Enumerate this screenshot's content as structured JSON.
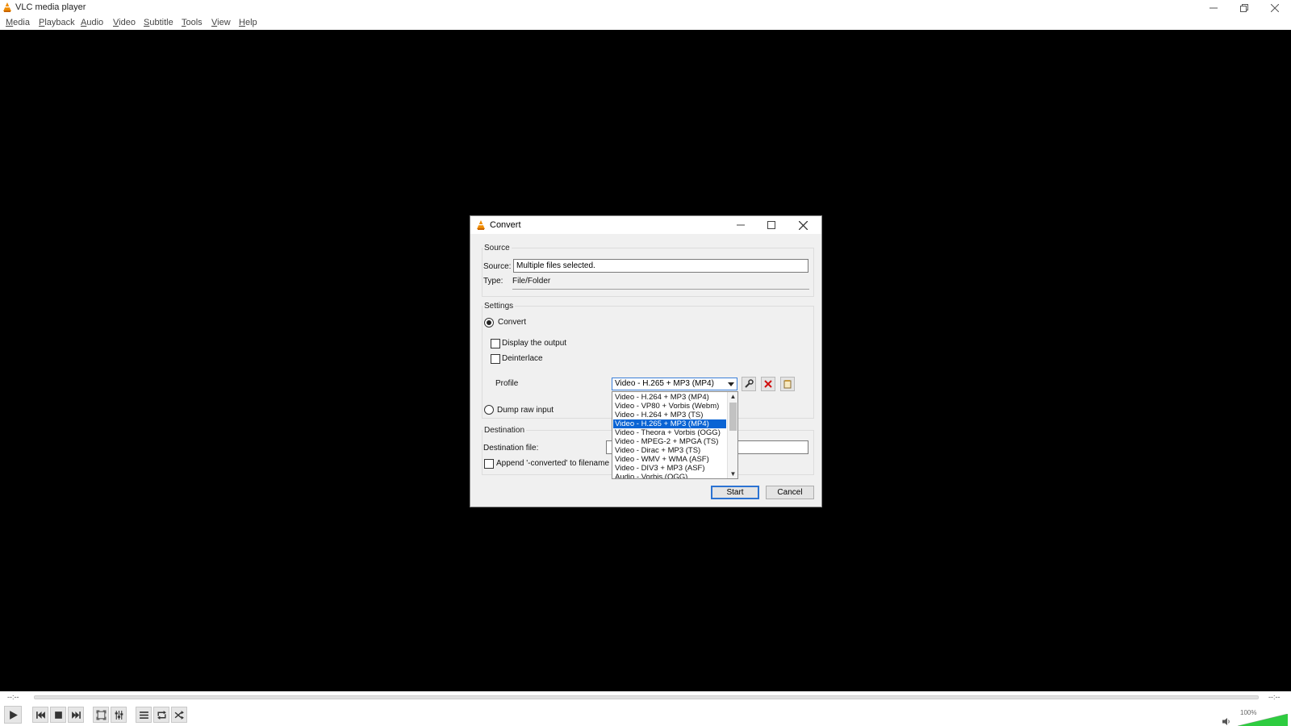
{
  "window": {
    "title": "VLC media player",
    "menu": [
      {
        "label": "Media",
        "key": "M",
        "rest": "edia"
      },
      {
        "label": "Playback",
        "key": "P",
        "rest": "layback"
      },
      {
        "label": "Audio",
        "key": "A",
        "rest": "udio"
      },
      {
        "label": "Video",
        "key": "V",
        "rest": "ideo"
      },
      {
        "label": "Subtitle",
        "key": "S",
        "rest": "ubtitle"
      },
      {
        "label": "Tools",
        "key": "T",
        "rest": "ools"
      },
      {
        "label": "View",
        "key": "V",
        "rest": "iew"
      },
      {
        "label": "Help",
        "key": "H",
        "rest": "elp"
      }
    ]
  },
  "player": {
    "elapsed": "--:--",
    "remaining": "--:--",
    "volume": "100%",
    "volume_level": 1.0
  },
  "dialog": {
    "title": "Convert",
    "source_group": "Source",
    "source_label": "Source:",
    "source_value": "Multiple files selected.",
    "type_label": "Type:",
    "type_value": "File/Folder",
    "settings_group": "Settings",
    "convert_radio": "Convert",
    "display_output": "Display the output",
    "deinterlace": "Deinterlace",
    "profile_label": "Profile",
    "profile_selected": "Video - H.265 + MP3 (MP4)",
    "profile_options": [
      "Video - H.264 + MP3 (MP4)",
      "Video - VP80 + Vorbis (Webm)",
      "Video - H.264 + MP3 (TS)",
      "Video - H.265 + MP3 (MP4)",
      "Video - Theora + Vorbis (OGG)",
      "Video - MPEG-2 + MPGA (TS)",
      "Video - Dirac + MP3 (TS)",
      "Video - WMV + WMA (ASF)",
      "Video - DIV3 + MP3 (ASF)",
      "Audio - Vorbis (OGG)"
    ],
    "dump_raw": "Dump raw input",
    "destination_group": "Destination",
    "destination_label": "Destination file:",
    "append_converted": "Append '-converted' to filename",
    "start_label": "Start",
    "cancel_label": "Cancel"
  },
  "icons": {
    "app": "vlc-cone-icon",
    "minimize": "minimize-icon",
    "maximize": "maximize-icon",
    "close": "close-icon",
    "edit_profile": "wrench-icon",
    "delete_profile": "delete-icon",
    "new_profile": "new-profile-icon"
  },
  "colors": {
    "vlc_orange": "#f08c00",
    "selection": "#0a64d4",
    "delete_red": "#d01010",
    "volume_green": "#2ecc40"
  }
}
